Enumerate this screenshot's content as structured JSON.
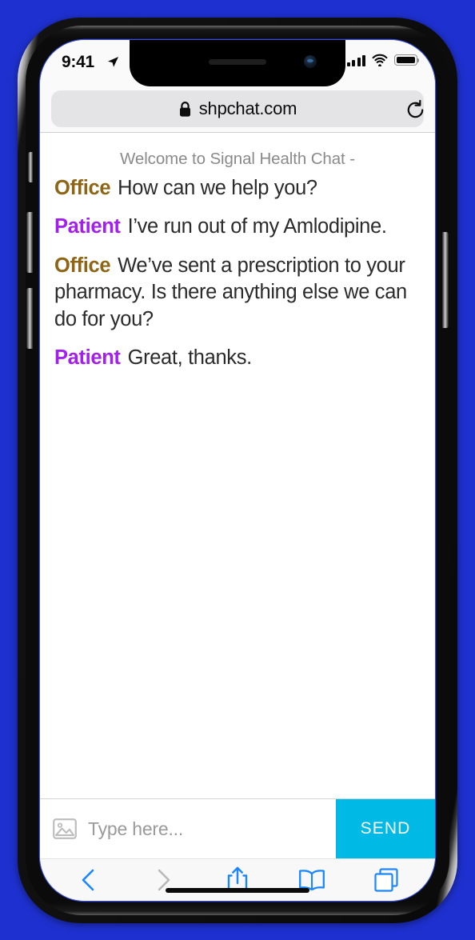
{
  "background_color": "#1e31d0",
  "status_bar": {
    "time": "9:41",
    "location_icon": "location-arrow-icon",
    "signal_icon": "cellular-signal-icon",
    "wifi_icon": "wifi-icon",
    "battery_icon": "battery-full-icon"
  },
  "browser": {
    "lock_icon": "lock-icon",
    "url": "shpchat.com",
    "reload_icon": "reload-icon",
    "toolbar": {
      "back_label": "back-icon",
      "forward_label": "forward-icon",
      "share_label": "share-icon",
      "bookmarks_label": "bookmarks-icon",
      "tabs_label": "tabs-icon",
      "back_color": "#1a86ff",
      "forward_color": "#b9b9b9",
      "icon_color": "#1a86ff"
    }
  },
  "chat": {
    "welcome": "Welcome to Signal Health Chat -",
    "messages": [
      {
        "sender": "Office",
        "role": "office",
        "text": "How can we help you?"
      },
      {
        "sender": "Patient",
        "role": "patient",
        "text": "I’ve run out of my Amlodipine."
      },
      {
        "sender": "Office",
        "role": "office",
        "text": "We’ve sent a prescription to your pharmacy. Is there anything else we can do for you?"
      },
      {
        "sender": "Patient",
        "role": "patient",
        "text": "Great, thanks."
      }
    ],
    "sender_colors": {
      "office": "#8e6415",
      "patient": "#a21ff0"
    }
  },
  "composer": {
    "image_icon": "image-attachment-icon",
    "input_value": "",
    "placeholder": "Type here...",
    "send_label": "SEND",
    "send_color": "#00b9e4"
  }
}
